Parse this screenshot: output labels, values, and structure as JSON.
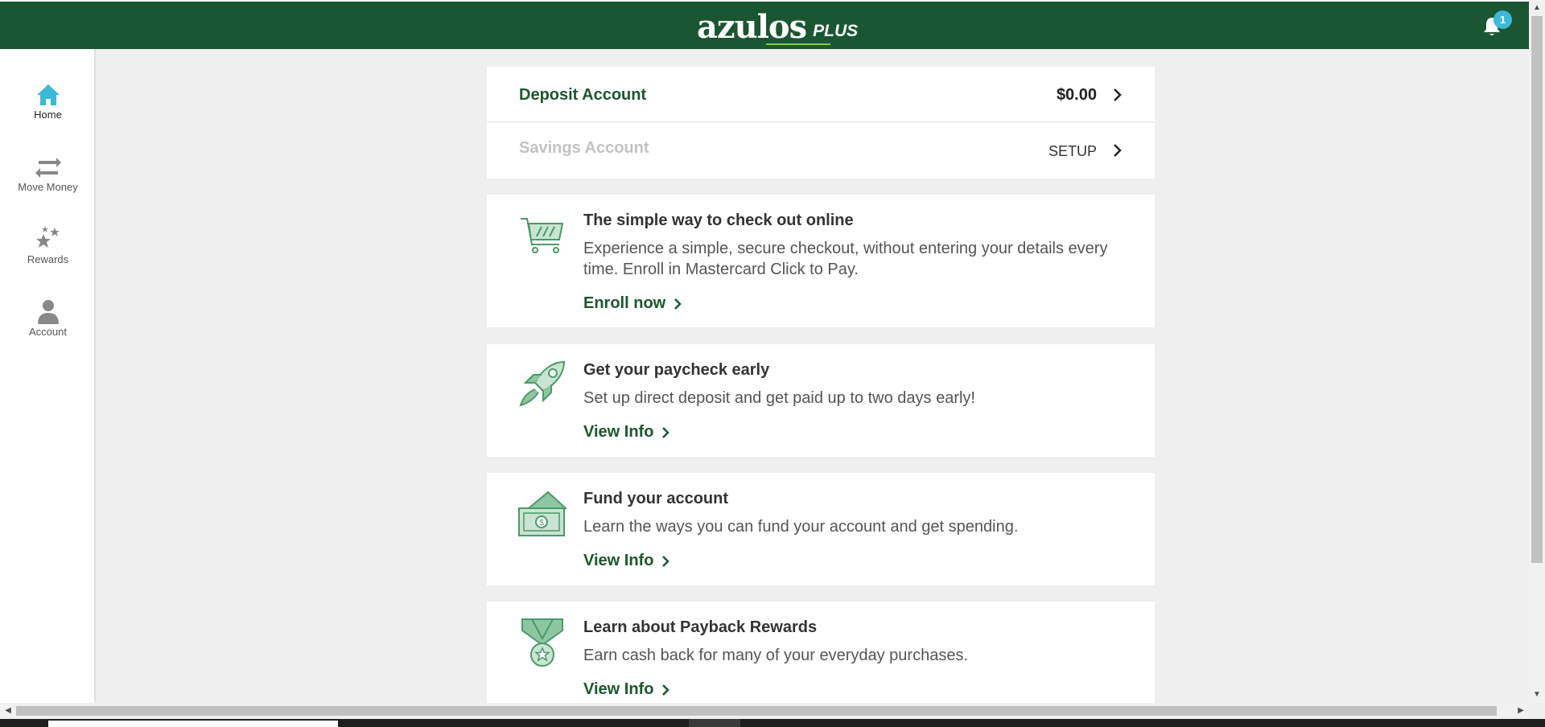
{
  "header": {
    "logo_main": "azulos",
    "logo_plus": "PLUS",
    "notification_count": "1",
    "colors": {
      "brand_green": "#1b5632",
      "badge": "#3cb8d8",
      "accent": "#8cc63f"
    }
  },
  "sidebar": {
    "items": [
      {
        "label": "Home",
        "icon": "home-icon",
        "active": true
      },
      {
        "label": "Move Money",
        "icon": "transfer-arrows-icon",
        "active": false
      },
      {
        "label": "Rewards",
        "icon": "stars-icon",
        "active": false
      },
      {
        "label": "Account",
        "icon": "user-icon",
        "active": false
      }
    ]
  },
  "accounts": {
    "deposit": {
      "label": "Deposit Account",
      "value": "$0.00"
    },
    "savings": {
      "label": "Savings Account",
      "action": "SETUP"
    }
  },
  "promos": [
    {
      "icon": "shopping-cart-icon",
      "title": "The simple way to check out online",
      "description": "Experience a simple, secure checkout, without entering your details every time. Enroll in Mastercard Click to Pay.",
      "link": "Enroll now"
    },
    {
      "icon": "rocket-icon",
      "title": "Get your paycheck early",
      "description": "Set up direct deposit and get paid up to two days early!",
      "link": "View Info"
    },
    {
      "icon": "money-card-icon",
      "title": "Fund your account",
      "description": "Learn the ways you can fund your account and get spending.",
      "link": "View Info"
    },
    {
      "icon": "medal-icon",
      "title": "Learn about Payback Rewards",
      "description": "Earn cash back for many of your everyday purchases.",
      "link": "View Info"
    }
  ]
}
